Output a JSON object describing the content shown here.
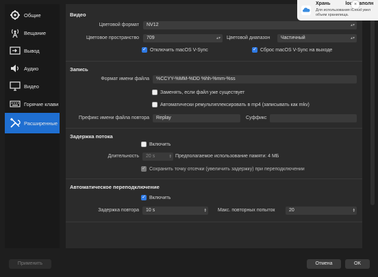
{
  "sidebar": {
    "items": [
      {
        "label": "Общие",
        "icon": "gear-icon"
      },
      {
        "label": "Вещание",
        "icon": "broadcast-icon"
      },
      {
        "label": "Вывод",
        "icon": "output-icon"
      },
      {
        "label": "Аудио",
        "icon": "speaker-icon"
      },
      {
        "label": "Видео",
        "icon": "monitor-icon"
      },
      {
        "label": "Горячие клави",
        "icon": "keyboard-icon"
      },
      {
        "label": "Расширенные",
        "icon": "tools-icon",
        "active": true
      }
    ]
  },
  "video": {
    "title": "Видео",
    "color_format_label": "Цветовой формат",
    "color_format_value": "NV12",
    "color_space_label": "Цветовое пространство",
    "color_space_value": "709",
    "color_range_label": "Цветовой диапазон",
    "color_range_value": "Частичный",
    "disable_vsync_label": "Отключить macOS V-Sync",
    "disable_vsync_checked": true,
    "reset_vsync_label": "Сброс macOS V-Sync на выходе",
    "reset_vsync_checked": true
  },
  "recording": {
    "title": "Запись",
    "filename_format_label": "Формат имени файла",
    "filename_format_value": "%CCYY-%MM-%DD %hh-%mm-%ss",
    "overwrite_label": "Заменять, если файл уже существует",
    "overwrite_checked": false,
    "auto_remux_label": "Автоматически ремультиплексировать в mp4 (записывать как mkv)",
    "auto_remux_checked": false,
    "replay_prefix_label": "Префикс имени файла повтора",
    "replay_prefix_value": "Replay",
    "suffix_label": "Суффикс",
    "suffix_value": ""
  },
  "stream_delay": {
    "title": "Задержка потока",
    "enable_label": "Включить",
    "enable_checked": false,
    "duration_label": "Длительность",
    "duration_value": "20 s",
    "memory_estimate": "Предполагаемое использование памяти: 4 МБ",
    "preserve_label": "Сохранить точку отсечки (увеличить задержку) при переподключении",
    "preserve_checked": true
  },
  "auto_reconnect": {
    "title": "Автоматическое переподключение",
    "enable_label": "Включить",
    "enable_checked": true,
    "retry_delay_label": "Задержка повтора",
    "retry_delay_value": "10 s",
    "max_retries_label": "Макс. повторных попыток",
    "max_retries_value": "20"
  },
  "footer": {
    "apply_label": "Применить",
    "cancel_label": "Отмена",
    "ok_label": "OK"
  },
  "notification": {
    "title": "Хранилище iCloud заполнено",
    "title_visible": "Хрань",
    "title_visible_right": "loud заполн",
    "body_line1": "Для использования iCloud увел",
    "body_line2": "объем хранилища.",
    "icon": "icloud-icon",
    "close_symbol": "×"
  },
  "colors": {
    "accent": "#1f6fd1",
    "checkbox_on": "#2f7ae5",
    "background": "#1e1e1e",
    "panel": "#2a2a2a"
  }
}
